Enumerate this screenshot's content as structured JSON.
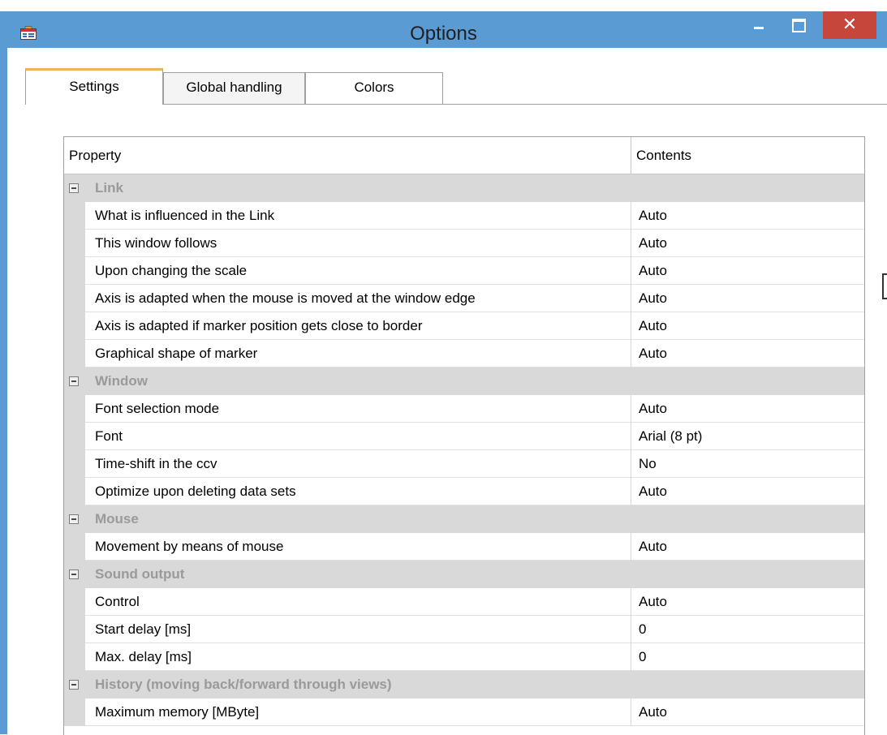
{
  "outer_text": "",
  "window": {
    "title": "Options",
    "icon": "property-grid-icon"
  },
  "titlebar_buttons": {
    "minimize": "minimize-icon",
    "maximize": "maximize-icon",
    "close": "✕"
  },
  "tabs": [
    {
      "label": "Settings",
      "active": true
    },
    {
      "label": "Global handling",
      "active": false
    },
    {
      "label": "Colors",
      "active": false
    }
  ],
  "grid": {
    "header": {
      "property": "Property",
      "contents": "Contents"
    },
    "categories": [
      {
        "label": "Link",
        "rows": [
          {
            "name": "What is influenced in the Link",
            "value": "Auto"
          },
          {
            "name": "This window follows",
            "value": "Auto"
          },
          {
            "name": "Upon changing the scale",
            "value": "Auto"
          },
          {
            "name": "Axis is adapted when the mouse is moved at the window edge",
            "value": "Auto"
          },
          {
            "name": "Axis is adapted if marker position gets close to border",
            "value": "Auto"
          },
          {
            "name": "Graphical shape of marker",
            "value": "Auto"
          }
        ]
      },
      {
        "label": "Window",
        "rows": [
          {
            "name": "Font selection mode",
            "value": "Auto"
          },
          {
            "name": "Font",
            "value": "Arial (8 pt)"
          },
          {
            "name": "Time-shift in the ccv",
            "value": "No"
          },
          {
            "name": "Optimize upon deleting data sets",
            "value": "Auto"
          }
        ]
      },
      {
        "label": "Mouse",
        "rows": [
          {
            "name": "Movement by means of mouse",
            "value": "Auto"
          }
        ]
      },
      {
        "label": "Sound output",
        "rows": [
          {
            "name": "Control",
            "value": "Auto"
          },
          {
            "name": "Start delay [ms]",
            "value": "0"
          },
          {
            "name": "Max. delay [ms]",
            "value": "0"
          }
        ]
      },
      {
        "label": "History (moving back/forward through views)",
        "rows": [
          {
            "name": "Maximum memory [MByte]",
            "value": "Auto"
          }
        ]
      }
    ]
  },
  "colors": {
    "titlebar": "#5a9bd3",
    "close": "#c7463b",
    "category_bg": "#d9d9d9",
    "category_text": "#9a9a9a",
    "active_tab_accent": "#f0b15a"
  }
}
